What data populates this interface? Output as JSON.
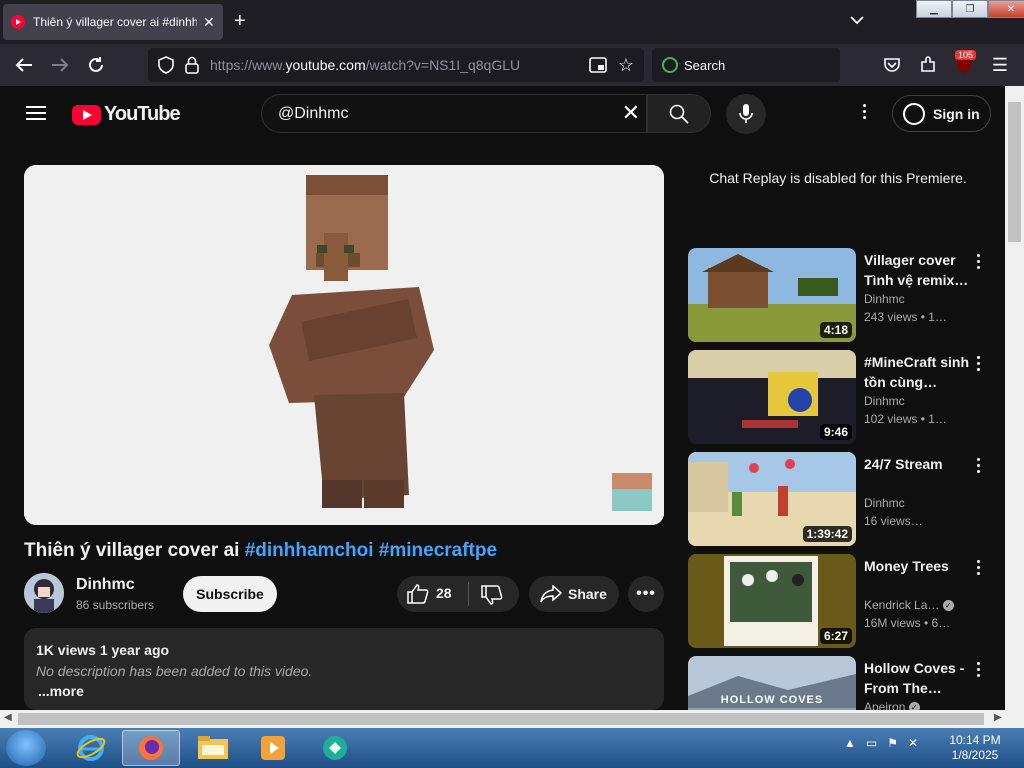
{
  "browser": {
    "tab_title": "Thiên ý villager cover ai #dinhhamchoi #minecraftpe",
    "url_prefix": "https://www.",
    "url_domain": "youtube.com",
    "url_rest": "/watch?v=NS1I_q8qGLU",
    "search_placeholder": "Search",
    "notification_count": "105"
  },
  "youtube": {
    "logo_text": "YouTube",
    "search_query": "@Dinhmc",
    "sign_in_label": "Sign in",
    "video": {
      "title_plain": "Thiên ý villager cover ai ",
      "title_tags": "#dinhhamchoi #minecraftpe",
      "channel_name": "Dinhmc",
      "subscribers": "86 subscribers",
      "subscribe_label": "Subscribe",
      "likes": "28",
      "share_label": "Share",
      "views_date": "1K views  1 year ago",
      "description": "No description has been added to this video.",
      "more_label": "...more"
    },
    "chat_note": "Chat Replay is disabled for this Premiere.",
    "recommendations": [
      {
        "title": "Villager cover Tình vệ remix…",
        "channel": "Dinhmc",
        "views": "243 views • 1…",
        "duration": "4:18"
      },
      {
        "title": "#MineCraft sinh tồn cùng…",
        "channel": "Dinhmc",
        "views": "102 views • 1…",
        "duration": "9:46"
      },
      {
        "title": "24/7 Stream",
        "channel": "Dinhmc",
        "views": "16 views…",
        "duration": "1:39:42"
      },
      {
        "title": "Money Trees",
        "channel": "Kendrick La…",
        "views": "16M views • 6…",
        "duration": "6:27"
      },
      {
        "title": "Hollow Coves - From The…",
        "channel": "Apeiron",
        "views": "",
        "duration": "",
        "thumb_text": "HOLLOW COVES"
      }
    ]
  },
  "taskbar": {
    "time": "10:14 PM",
    "date": "1/8/2025"
  }
}
